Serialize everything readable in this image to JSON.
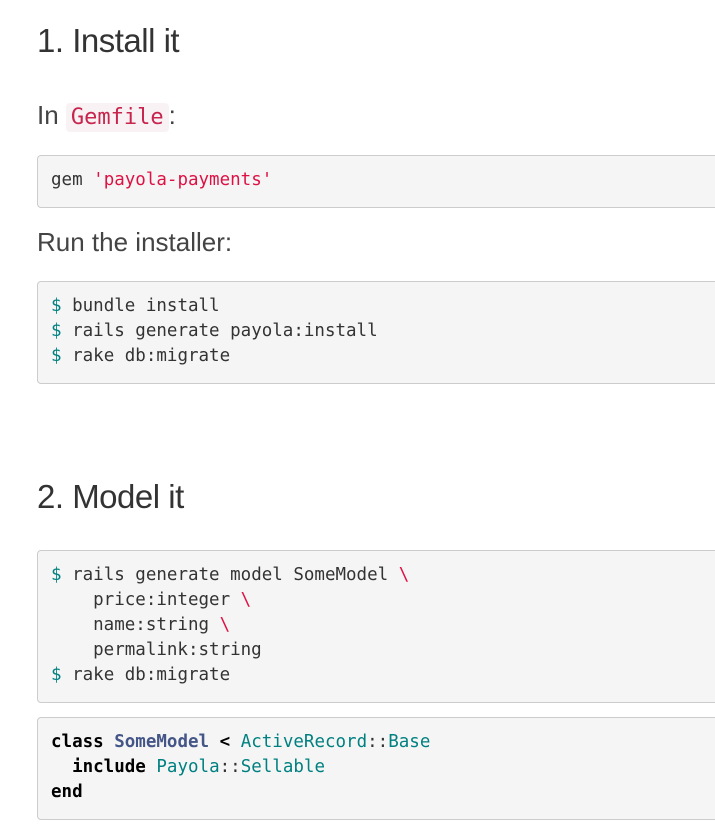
{
  "sections": [
    {
      "heading": "1. Install it"
    },
    {
      "heading": "2. Model it"
    }
  ],
  "install": {
    "gemfile_prefix": "In ",
    "gemfile_code": "Gemfile",
    "gemfile_suffix": ":",
    "gem_keyword": "gem ",
    "gem_name": "'payola-payments'",
    "installer_text": "Run the installer:",
    "installer_lines": [
      {
        "prompt": "$",
        "cmd": " bundle install"
      },
      {
        "prompt": "$",
        "cmd": " rails generate payola:install"
      },
      {
        "prompt": "$",
        "cmd": " rake db:migrate"
      }
    ]
  },
  "model": {
    "generate_lines": [
      {
        "prompt": "$",
        "cmd": " rails generate model SomeModel ",
        "cont": "\\"
      },
      {
        "prompt": "",
        "cmd": "    price:integer ",
        "cont": "\\"
      },
      {
        "prompt": "",
        "cmd": "    name:string ",
        "cont": "\\"
      },
      {
        "prompt": "",
        "cmd": "    permalink:string",
        "cont": ""
      },
      {
        "prompt": "$",
        "cmd": " rake db:migrate",
        "cont": ""
      }
    ],
    "class_code": {
      "kw_class": "class",
      "class_name": "SomeModel",
      "lt": "<",
      "parent_module": "ActiveRecord",
      "sep": "::",
      "parent_class": "Base",
      "kw_include": "include",
      "inc_module": "Payola",
      "inc_class": "Sellable",
      "kw_end": "end"
    }
  },
  "colors": {
    "string": "#dd1144",
    "prompt": "#008080",
    "class_name": "#445588",
    "constant": "#008080",
    "inline_code": "#c7254e",
    "code_bg": "#f5f5f5"
  }
}
